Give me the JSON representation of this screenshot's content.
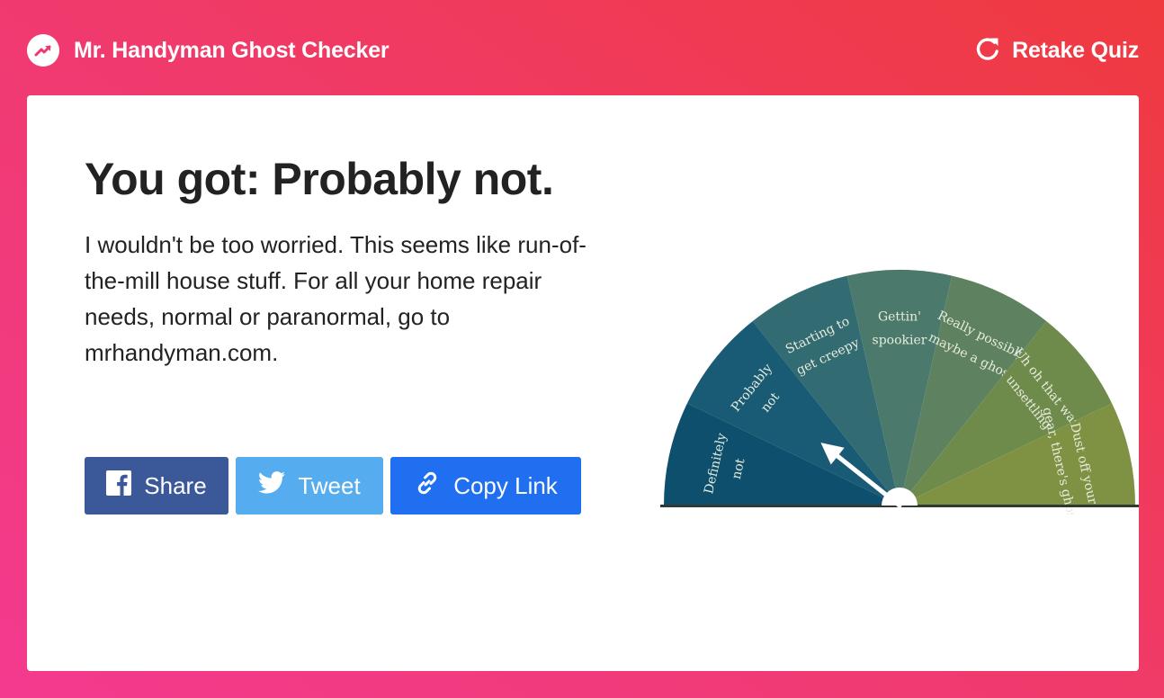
{
  "header": {
    "brand_icon": "trending-up-icon",
    "brand_title": "Mr. Handyman Ghost Checker",
    "retake_icon": "refresh-icon",
    "retake_label": "Retake Quiz"
  },
  "result": {
    "title": "You got: Probably not.",
    "description": "I wouldn't be too worried. This seems like run-of-the-mill house stuff. For all your home repair needs, normal or paranormal, go to mrhandyman.com."
  },
  "share": {
    "facebook_label": "Share",
    "twitter_label": "Tweet",
    "copy_label": "Copy Link"
  },
  "meter": {
    "segments": [
      {
        "line1": "Definitely",
        "line2": "not",
        "color": "#0f4f6e"
      },
      {
        "line1": "Probably",
        "line2": "not",
        "color": "#195a75"
      },
      {
        "line1": "Starting to",
        "line2": "get creepy",
        "color": "#326b72"
      },
      {
        "line1": "Gettin'",
        "line2": "spookier",
        "color": "#4b7a6c"
      },
      {
        "line1": "Really possibly",
        "line2": "maybe a ghost",
        "color": "#5e8260"
      },
      {
        "line1": "Uh oh that was",
        "line2": "unsettling",
        "color": "#6f8b4c"
      },
      {
        "line1": "Dust off your",
        "line2": "gear, there's ghosts",
        "color": "#7f9243"
      }
    ],
    "selected_segment": 1
  },
  "colors": {
    "brand_gradient_start": "#f33a8f",
    "brand_gradient_end": "#ef3a3f",
    "facebook": "#3b5998",
    "twitter": "#55acee",
    "copy_link": "#1f6ff0"
  }
}
